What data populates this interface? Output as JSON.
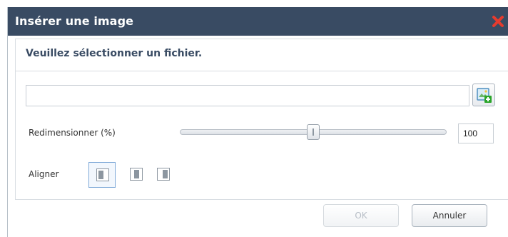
{
  "dialog": {
    "title": "Insérer une image",
    "close_icon": "close-x-icon",
    "colors": {
      "titlebar": "#394b63",
      "close": "#e63b2e",
      "accent": "#7fa9d8"
    }
  },
  "panel": {
    "instruction": "Veuillez sélectionner un fichier.",
    "file_input": {
      "value": "",
      "placeholder": ""
    },
    "add_file_icon": "add-image-icon",
    "resize": {
      "label": "Redimensionner (%)",
      "value": "100",
      "slider_position": 0.5
    },
    "align": {
      "label": "Aligner",
      "options": [
        {
          "name": "left",
          "icon": "align-left-icon",
          "selected": true
        },
        {
          "name": "center",
          "icon": "align-center-icon",
          "selected": false
        },
        {
          "name": "right",
          "icon": "align-right-icon",
          "selected": false
        }
      ]
    }
  },
  "footer": {
    "ok_label": "OK",
    "cancel_label": "Annuler"
  }
}
